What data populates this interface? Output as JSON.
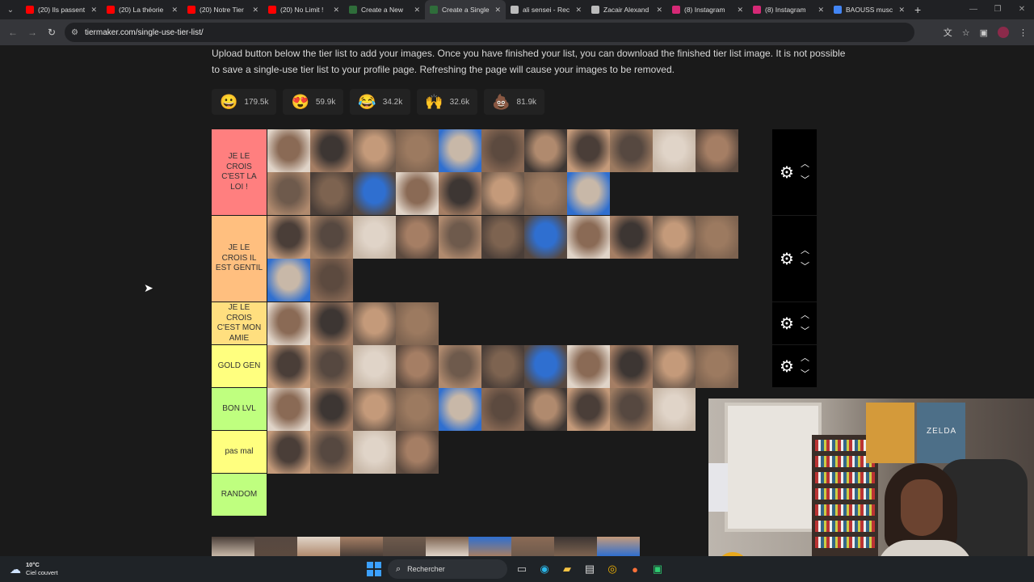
{
  "browser": {
    "tabs": [
      {
        "title": "(20) Ils passent",
        "color": "#ff0000"
      },
      {
        "title": "(20) La théorie",
        "color": "#ff0000"
      },
      {
        "title": "(20) Notre Tier",
        "color": "#ff0000"
      },
      {
        "title": "(20) No Limit !",
        "color": "#ff0000"
      },
      {
        "title": "Create a New",
        "color": "#2f6d3a"
      },
      {
        "title": "Create a Single",
        "color": "#2f6d3a"
      },
      {
        "title": "ali sensei - Rec",
        "color": "#bbbbbb"
      },
      {
        "title": "Zacair Alexand",
        "color": "#bbbbbb"
      },
      {
        "title": "(8) Instagram",
        "color": "#d62976"
      },
      {
        "title": "(8) Instagram",
        "color": "#d62976"
      },
      {
        "title": "BAOUSS musc",
        "color": "#4285f4"
      }
    ],
    "active_tab_index": 5,
    "url": "tiermaker.com/single-use-tier-list/"
  },
  "page": {
    "intro_line1": "Upload button below the tier list to add your images. Once you have finished your list, you can download the finished tier list image. It is not possible",
    "intro_line2": "to save a single-use tier list to your profile page. Refreshing the page will cause your images to be removed.",
    "reactions": [
      {
        "icon": "😀",
        "count": "179.5k"
      },
      {
        "icon": "😍",
        "count": "59.9k"
      },
      {
        "icon": "😂",
        "count": "34.2k"
      },
      {
        "icon": "🙌",
        "count": "32.6k"
      },
      {
        "icon": "💩",
        "count": "81.9k"
      }
    ],
    "tiers": [
      {
        "label": "JE LE CROIS C'EST LA LOI !",
        "color": "#ff7f7f",
        "count": 19,
        "rows": 2,
        "controls": true
      },
      {
        "label": "JE LE CROIS IL EST GENTIL",
        "color": "#ffbf7f",
        "count": 13,
        "rows": 2,
        "controls": true
      },
      {
        "label": "JE LE CROIS C'EST MON AMIE",
        "color": "#ffdf7f",
        "count": 4,
        "rows": 1,
        "controls": true
      },
      {
        "label": "GOLD GEN",
        "color": "#ffff7f",
        "count": 11,
        "rows": 1,
        "controls": true
      },
      {
        "label": "BON LVL",
        "color": "#bfff7f",
        "count": 10,
        "rows": 1,
        "controls": false
      },
      {
        "label": "pas mal",
        "color": "#ffff7f",
        "count": 4,
        "rows": 1,
        "controls": false
      },
      {
        "label": "RANDOM",
        "color": "#bfff7f",
        "count": 0,
        "rows": 1,
        "controls": false
      }
    ]
  },
  "webcam": {
    "poster_text": "ZELDA"
  },
  "taskbar": {
    "temperature": "10°C",
    "weather": "Ciel couvert",
    "search_label": "Rechercher"
  }
}
